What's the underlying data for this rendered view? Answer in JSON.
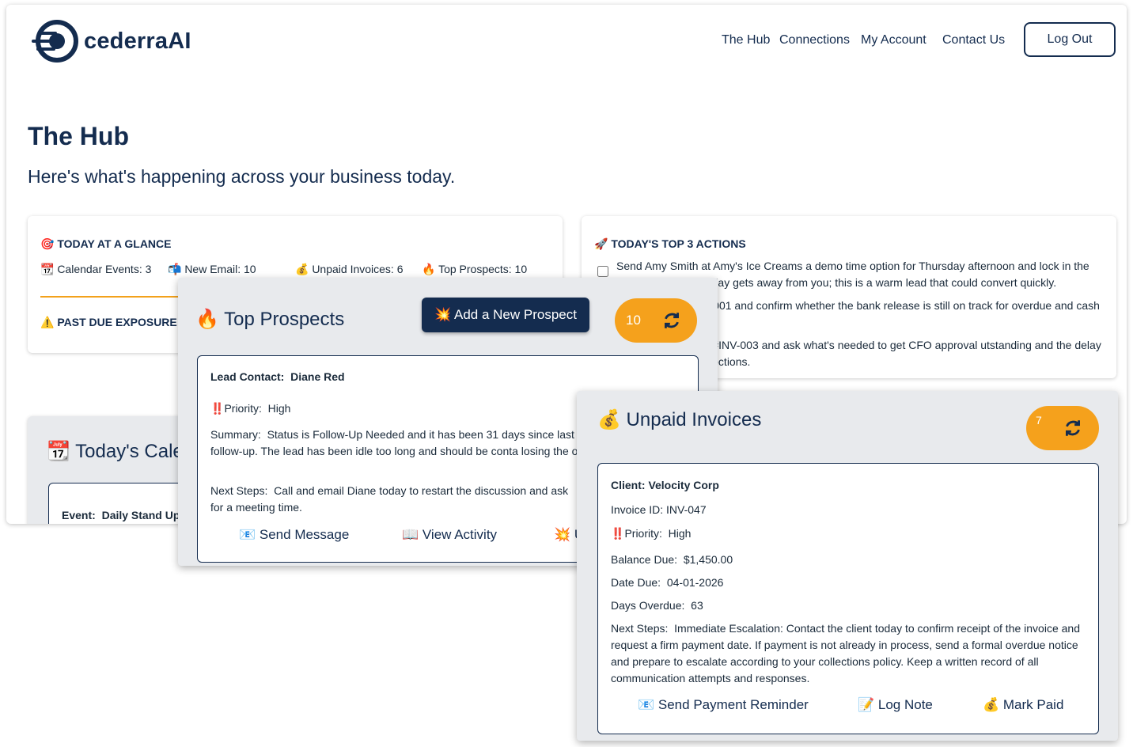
{
  "brand": {
    "name": "cederraAI"
  },
  "nav": {
    "links": [
      "The Hub",
      "Connections",
      "My Account",
      "Contact Us"
    ],
    "logout_label": "Log Out"
  },
  "page": {
    "title": "The Hub",
    "subtitle": "Here's what's happening across your business today."
  },
  "glance": {
    "heading": "🎯 TODAY AT A GLANCE",
    "stats": [
      "📆 Calendar Events: 3",
      "📬 New Email: 10",
      "💰 Unpaid Invoices: 6",
      "🔥 Top Prospects: 10"
    ],
    "past_due_label": "⚠️ PAST DUE EXPOSURE:",
    "past_due_value": "$"
  },
  "top_actions": {
    "heading": "🚀 TODAY'S TOP 3 ACTIONS",
    "items": [
      "Send Amy Smith at Amy's Ice Creams a demo time option for Thursday afternoon and lock in the meeting before the day gets away from you; this is a warm lead that could convert quickly.",
      "about Invoice #INV-001 and confirm whether the bank release is still on track for overdue and cash flow is waiting on it.",
      "McNally on Invoice #INV-003 and ask what's needed to get CFO approval utstanding and the delay is now affecting collections."
    ]
  },
  "calendar": {
    "title": "📆 Today's Calen",
    "event_label": "Event:",
    "event_value": "Daily Stand Up"
  },
  "prospects": {
    "title": "🔥 Top Prospects",
    "add_button": "💥 Add a New Prospect",
    "count": "10",
    "lead_label": "Lead Contact:",
    "lead_value": "Diane Red",
    "priority_label": "‼️Priority:",
    "priority_value": "High",
    "summary_label": "Summary:",
    "summary_value": "Status is Follow-Up Needed and it has been 31 days since last cont a high-priority follow-up. The lead has been idle too long and should be conta losing the opportunity.",
    "next_steps_label": "Next Steps:",
    "next_steps_value": "Call and email Diane today to restart the discussion and ask for a meeting time.",
    "actions": [
      "📧 Send Message",
      "📖 View Activity",
      "💥 U"
    ]
  },
  "invoices": {
    "title": "💰 Unpaid Invoices",
    "count": "7",
    "client": "Client: Velocity Corp",
    "invoice_id": "Invoice ID: INV-047",
    "priority_label": "‼️Priority:",
    "priority_value": "High",
    "balance_label": "Balance Due:",
    "balance_value": "$1,450.00",
    "date_label": "Date Due:",
    "date_value": "04-01-2026",
    "days_label": "Days Overdue:",
    "days_value": "63",
    "next_steps_label": "Next Steps:",
    "next_steps_value": "Immediate Escalation: Contact the client today to confirm receipt of the invoice and request a firm payment date. If payment is not already in process, send a formal overdue notice and prepare to escalate according to your collections policy. Keep a written record of all communication attempts and responses.",
    "actions": [
      "📧 Send Payment Reminder",
      "📝 Log Note",
      "💰 Mark Paid"
    ]
  },
  "colors": {
    "navy": "#142c4f",
    "accent_orange": "#f5a11c",
    "panel_gray": "#e8eaed",
    "priority_red": "#d32f2f"
  }
}
